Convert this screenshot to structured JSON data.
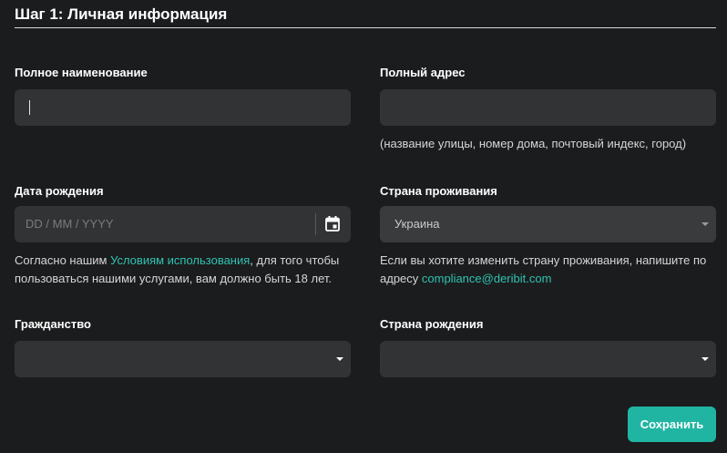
{
  "form": {
    "title": "Шаг 1: Личная информация",
    "full_name": {
      "label": "Полное наименование",
      "value": ""
    },
    "full_address": {
      "label": "Полный адрес",
      "value": "",
      "hint": "(название улицы, номер дома, почтовый индекс, город)"
    },
    "birth_date": {
      "label": "Дата рождения",
      "placeholder": "DD / MM / YYYY",
      "icon": "calendar-icon",
      "hint_prefix": "Согласно нашим ",
      "hint_link": "Условиям использования",
      "hint_suffix_line1": ", для того чтобы",
      "hint_line2": "пользоваться нашими услугами, вам должно быть 18 лет."
    },
    "residence_country": {
      "label": "Страна проживания",
      "value": "Украина",
      "hint_line1": "Если вы хотите изменить страну проживания, напишите по",
      "hint_prefix2": "адресу ",
      "hint_email": "compliance@deribit.com"
    },
    "citizenship": {
      "label": "Гражданство",
      "value": ""
    },
    "birth_country": {
      "label": "Страна рождения",
      "value": ""
    },
    "save_label": "Сохранить"
  },
  "colors": {
    "background": "#1b1c1e",
    "field": "#323335",
    "accent": "#20b5a3",
    "link": "#2fc3b0"
  }
}
